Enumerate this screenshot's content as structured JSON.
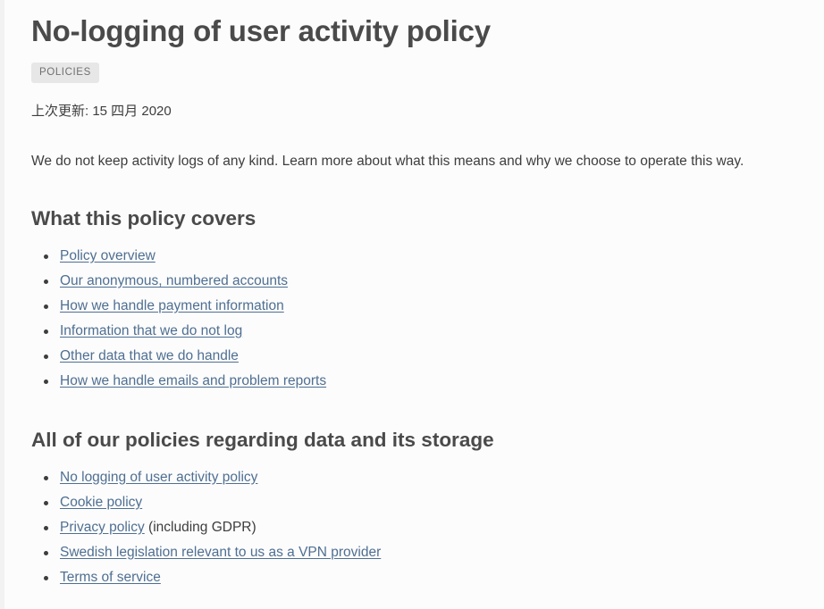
{
  "article": {
    "title": "No-logging of user activity policy",
    "badge": "POLICIES",
    "last_updated": "上次更新: 15 四月 2020",
    "intro": "We do not keep activity logs of any kind. Learn more about what this means and why we choose to operate this way.",
    "sections": [
      {
        "heading": "What this policy covers",
        "links": [
          {
            "label": "Policy overview",
            "suffix": ""
          },
          {
            "label": "Our anonymous, numbered accounts",
            "suffix": ""
          },
          {
            "label": "How we handle payment information",
            "suffix": ""
          },
          {
            "label": "Information that we do not log",
            "suffix": ""
          },
          {
            "label": "Other data that we do handle",
            "suffix": ""
          },
          {
            "label": "How we handle emails and problem reports",
            "suffix": ""
          }
        ]
      },
      {
        "heading": "All of our policies regarding data and its storage",
        "links": [
          {
            "label": "No logging of user activity policy",
            "suffix": ""
          },
          {
            "label": "Cookie policy",
            "suffix": ""
          },
          {
            "label": "Privacy policy",
            "suffix": " (including GDPR)"
          },
          {
            "label": "Swedish legislation relevant to us as a VPN provider",
            "suffix": ""
          },
          {
            "label": "Terms of service",
            "suffix": ""
          }
        ]
      }
    ]
  },
  "colors": {
    "page_background": "#fcfcfc",
    "heading_text": "#4a4a4a",
    "body_text": "#3d3d3d",
    "link": "#4f6f92",
    "badge_background": "#e7e7e7",
    "badge_text": "#707070",
    "left_rail": "#f2f2f2"
  }
}
